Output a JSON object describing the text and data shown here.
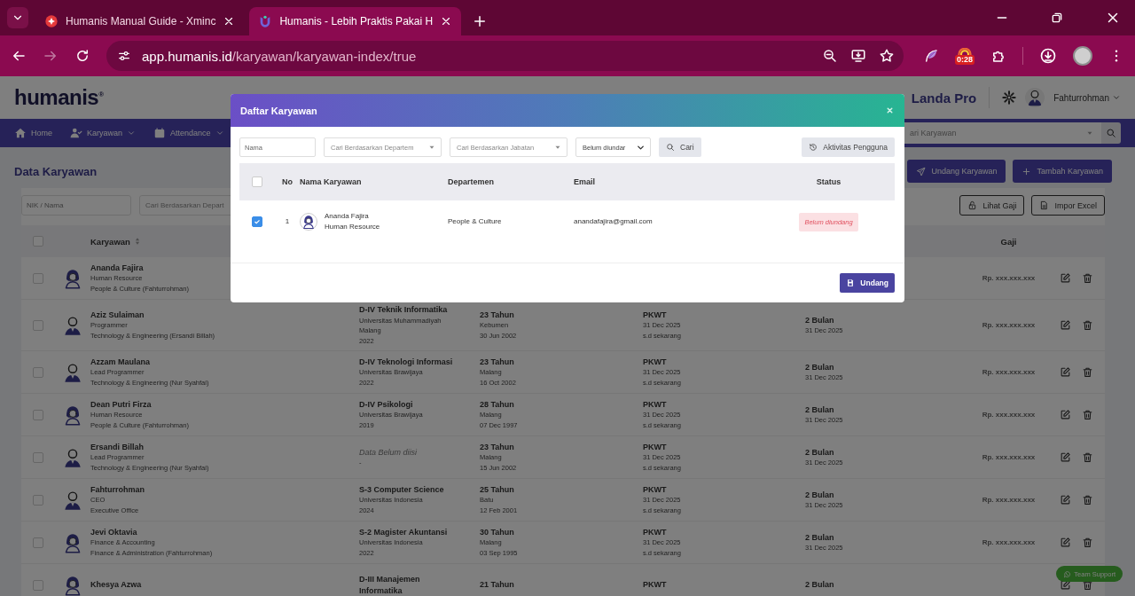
{
  "browser": {
    "tabs": [
      {
        "title": "Humanis Manual Guide - Xminc",
        "selected": false
      },
      {
        "title": "Humanis - Lebih Praktis Pakai H",
        "selected": true
      }
    ],
    "url": {
      "host": "app.humanis.id",
      "path": "/karyawan/karyawan-index/true"
    },
    "forward_disabled": true,
    "extension_badge": "0:28"
  },
  "app_header": {
    "logo": "humanis",
    "logo_mark": "®",
    "company": "Landa Pro",
    "user": "Fahturrohman"
  },
  "nav": {
    "items": [
      {
        "label": "Home",
        "dropdown": false
      },
      {
        "label": "Karyawan",
        "dropdown": true
      },
      {
        "label": "Attendance",
        "dropdown": true
      }
    ],
    "search_placeholder": "ari Karyawan"
  },
  "page": {
    "title": "Data Karyawan",
    "actions": [
      {
        "label": "Undang Karyawan"
      },
      {
        "label": "Tambah Karyawan"
      }
    ]
  },
  "filters": {
    "search_placeholder": "NIK / Nama",
    "department_placeholder": "Cari Berdasarkan Depart",
    "buttons": [
      {
        "label": "Lihat Gaji"
      },
      {
        "label": "Impor Excel"
      }
    ]
  },
  "table": {
    "all_selected": false,
    "columns": [
      {
        "label": "Karyawan",
        "sortable": true
      },
      {
        "label": "Gaji",
        "sortable": false
      }
    ],
    "rows": [
      {
        "selected": false,
        "kind": "female",
        "name": "Ananda Fajira",
        "role": "Human Resource",
        "department": "People & Culture (Fahturrohman)",
        "salary": "Rp. xxx.xxx.xxx"
      },
      {
        "selected": false,
        "kind": "male",
        "name": "Aziz Sulaiman",
        "role": "Programmer",
        "department": "Technology & Engineering (Ersandi Billah)",
        "education": {
          "title": "D-IV Teknik Informatika",
          "lines": [
            "Universitas Muhammadiyah Malang",
            "2022"
          ],
          "missing": false
        },
        "age": {
          "years": "23 Tahun",
          "place": "Kebumen",
          "birth": "30 Jun 2002"
        },
        "contract": {
          "type": "PKWT",
          "start": "31 Dec 2025",
          "until": "s.d sekarang"
        },
        "duration": {
          "length": "2 Bulan",
          "end": "31 Dec 2025"
        },
        "salary": "Rp. xxx.xxx.xxx"
      },
      {
        "selected": false,
        "kind": "male",
        "name": "Azzam Maulana",
        "role": "Lead Programmer",
        "department": "Technology & Engineering (Nur Syahfai)",
        "education": {
          "title": "D-IV Teknologi Informasi",
          "lines": [
            "Universitas Brawijaya",
            "2022"
          ],
          "missing": false
        },
        "age": {
          "years": "23 Tahun",
          "place": "Malang",
          "birth": "16 Oct 2002"
        },
        "contract": {
          "type": "PKWT",
          "start": "31 Dec 2025",
          "until": "s.d sekarang"
        },
        "duration": {
          "length": "2 Bulan",
          "end": "31 Dec 2025"
        },
        "salary": "Rp. xxx.xxx.xxx"
      },
      {
        "selected": false,
        "kind": "female",
        "name": "Dean Putri Firza",
        "role": "Human Resource",
        "department": "People & Culture (Fahturrohman)",
        "education": {
          "title": "D-IV Psikologi",
          "lines": [
            "Universitas Brawijaya",
            "2019"
          ],
          "missing": false
        },
        "age": {
          "years": "28 Tahun",
          "place": "Malang",
          "birth": "07 Dec 1997"
        },
        "contract": {
          "type": "PKWT",
          "start": "31 Dec 2025",
          "until": "s.d sekarang"
        },
        "duration": {
          "length": "2 Bulan",
          "end": "31 Dec 2025"
        },
        "salary": "Rp. xxx.xxx.xxx"
      },
      {
        "selected": false,
        "kind": "male",
        "name": "Ersandi Billah",
        "role": "Lead Programmer",
        "department": "Technology & Engineering (Nur Syahfai)",
        "education": {
          "title": "Data Belum diisi",
          "lines": [
            "-"
          ],
          "missing": true
        },
        "age": {
          "years": "23 Tahun",
          "place": "Malang",
          "birth": "15 Jun 2002"
        },
        "contract": {
          "type": "PKWT",
          "start": "31 Dec 2025",
          "until": "s.d sekarang"
        },
        "duration": {
          "length": "2 Bulan",
          "end": "31 Dec 2025"
        },
        "salary": "Rp. xxx.xxx.xxx"
      },
      {
        "selected": false,
        "kind": "male",
        "name": "Fahturrohman",
        "role": "CEO",
        "department": "Executive Office",
        "education": {
          "title": "S-3 Computer Science",
          "lines": [
            "Universitas Indonesia",
            "2024"
          ],
          "missing": false
        },
        "age": {
          "years": "25 Tahun",
          "place": "Batu",
          "birth": "12 Feb 2001"
        },
        "contract": {
          "type": "PKWT",
          "start": "31 Dec 2025",
          "until": "s.d sekarang"
        },
        "duration": {
          "length": "2 Bulan",
          "end": "31 Dec 2025"
        },
        "salary": "Rp. xxx.xxx.xxx"
      },
      {
        "selected": false,
        "kind": "female",
        "name": "Jevi Oktavia",
        "role": "Finance & Accounting",
        "department": "Finance & Administration (Fahturrohman)",
        "education": {
          "title": "S-2 Magister Akuntansi",
          "lines": [
            "Universitas Indonesia",
            "2022"
          ],
          "missing": false
        },
        "age": {
          "years": "30 Tahun",
          "place": "Malang",
          "birth": "03 Sep 1995"
        },
        "contract": {
          "type": "PKWT",
          "start": "31 Dec 2025",
          "until": "s.d sekarang"
        },
        "duration": {
          "length": "2 Bulan",
          "end": "31 Dec 2025"
        },
        "salary": "Rp. xxx.xxx.xxx"
      },
      {
        "selected": false,
        "kind": "female",
        "name": "Khesya Azwa",
        "education": {
          "title": "D-III Manajemen Informatika",
          "missing": false
        },
        "age": {
          "years": "21 Tahun"
        },
        "contract": {
          "type": "PKWT"
        },
        "duration": {
          "length": "2 Bulan"
        }
      }
    ]
  },
  "support": {
    "label": "Team Support"
  },
  "modal": {
    "title": "Daftar Karyawan",
    "filters": {
      "name_placeholder": "Nama",
      "selects": [
        {
          "text": "Cari Berdasarkan Departem",
          "kind": "placeholder"
        },
        {
          "text": "Cari Berdasarkan Jabatan",
          "kind": "placeholder"
        },
        {
          "text": "Belum diundar",
          "kind": "value"
        }
      ],
      "search_button": "Cari",
      "activity_button": "Aktivitas Pengguna"
    },
    "table": {
      "all_selected": false,
      "columns": [
        "No",
        "Nama Karyawan",
        "Departemen",
        "Email",
        "Status"
      ],
      "rows": [
        {
          "selected": true,
          "no": "1",
          "kind": "female",
          "name": "Ananda Fajira",
          "role": "Human Resource",
          "department": "People & Culture",
          "email": "anandafajira@gmail.com",
          "status": {
            "label": "Belum diundang",
            "kind": "pending"
          }
        }
      ]
    },
    "submit_button": "Undang"
  }
}
